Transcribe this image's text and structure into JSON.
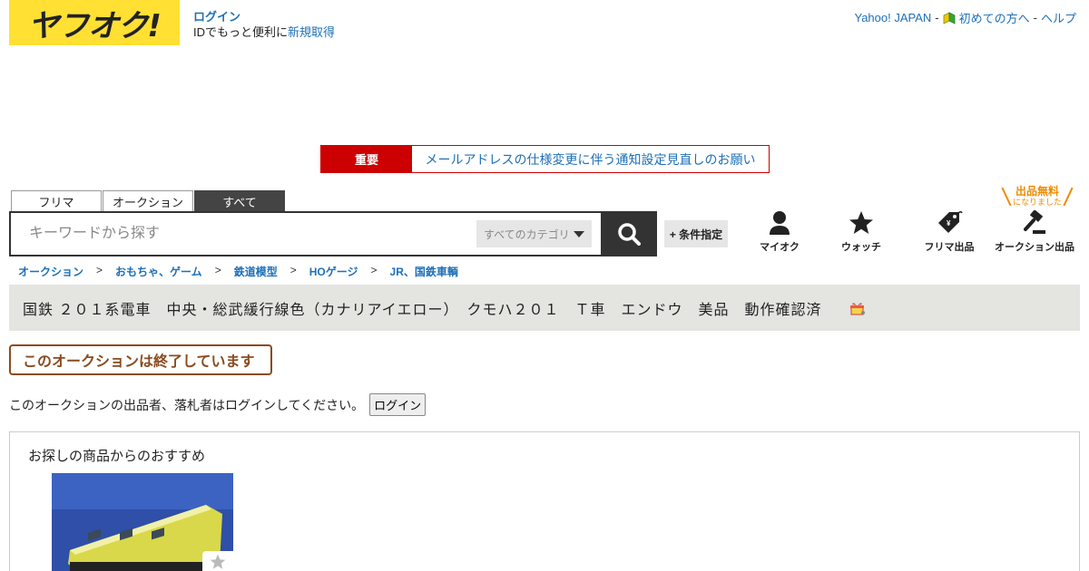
{
  "header": {
    "logo_text": "ヤフオク!",
    "login_link": "ログイン",
    "login_prefix": "IDでもっと便利に",
    "register_link": "新規取得",
    "yahoo_japan": "Yahoo! JAPAN",
    "first_time": "初めての方へ",
    "help": "ヘルプ",
    "sep": "-"
  },
  "notice": {
    "tag": "重要",
    "message": "メールアドレスの仕様変更に伴う通知設定見直しのお願い"
  },
  "search": {
    "tabs": [
      "フリマ",
      "オークション",
      "すべて"
    ],
    "active_tab": "すべて",
    "placeholder": "キーワードから探す",
    "category": "すべてのカテゴリ",
    "condition_button": "+ 条件指定"
  },
  "nav": {
    "myauc": "マイオク",
    "watch": "ウォッチ",
    "flea_listing": "フリマ出品",
    "auction_listing": "オークション出品",
    "free_badge_main": "出品無料",
    "free_badge_sub": "になりました"
  },
  "breadcrumb": [
    "オークション",
    "おもちゃ、ゲーム",
    "鉄道模型",
    "HOゲージ",
    "JR、国鉄車輌"
  ],
  "breadcrumb_sep": ">",
  "item": {
    "title": "国鉄 ２０１系電車　中央・総武緩行線色（カナリアイエロー）　クモハ２０１　Ｔ車　エンドウ　美品　動作確認済",
    "ended_label": "このオークションは終了しています",
    "login_note": "このオークションの出品者、落札者はログインしてください。",
    "login_button": "ログイン"
  },
  "recommend": {
    "heading": "お探しの商品からのおすすめ"
  },
  "colors": {
    "brand_yellow": "#ffe033",
    "link": "#1d70b8",
    "important_red": "#cc0000",
    "ended_brown": "#8a4b20",
    "free_orange": "#f08c00"
  }
}
